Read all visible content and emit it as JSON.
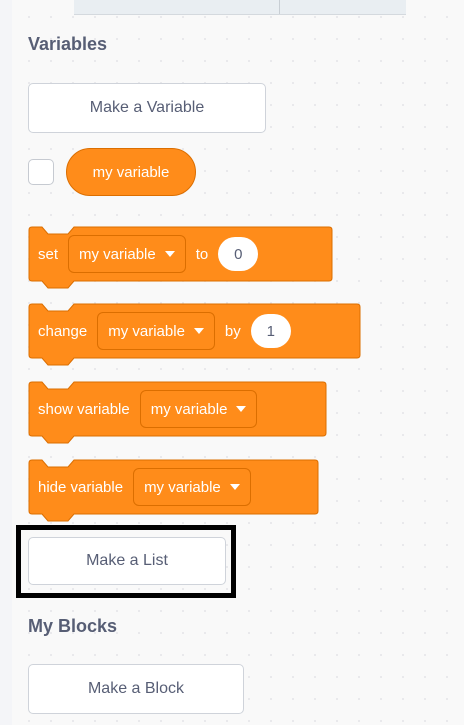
{
  "palette": {
    "variables_title": "Variables",
    "make_variable_label": "Make a Variable",
    "variable_reporter": "my variable",
    "blocks": {
      "set": {
        "label": "set",
        "dropdown": "my variable",
        "connector": "to",
        "value": "0"
      },
      "change": {
        "label": "change",
        "dropdown": "my variable",
        "connector": "by",
        "value": "1"
      },
      "show": {
        "label": "show variable",
        "dropdown": "my variable"
      },
      "hide": {
        "label": "hide variable",
        "dropdown": "my variable"
      }
    },
    "make_list_label": "Make a List",
    "my_blocks_title": "My Blocks",
    "make_block_label": "Make a Block"
  },
  "colors": {
    "variables_block": "#ff8c1a",
    "variables_block_border": "#db6e00",
    "section_title": "#575e75",
    "highlight": "#000000"
  }
}
